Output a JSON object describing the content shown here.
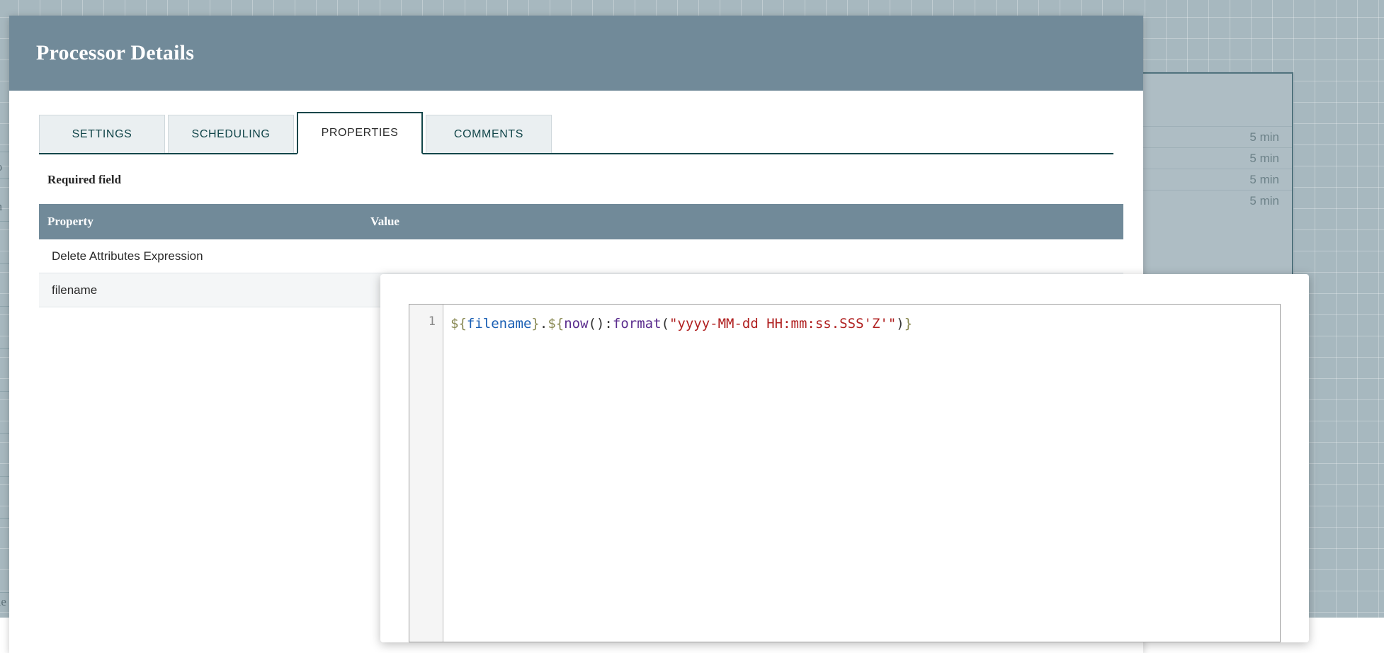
{
  "canvas": {
    "background_color": "#a7b8bf",
    "edge_fragments": [
      "to",
      "m",
      "n",
      "Re"
    ],
    "background_processor": {
      "border_color": "#50727d",
      "fill_color": "#aebdc4",
      "rows": [
        "5 min",
        "5 min",
        "5 min",
        "5 min"
      ]
    }
  },
  "dialog": {
    "title": "Processor Details",
    "header_color": "#718a99",
    "tabs": [
      {
        "label": "SETTINGS",
        "active": false
      },
      {
        "label": "SCHEDULING",
        "active": false
      },
      {
        "label": "PROPERTIES",
        "active": true
      },
      {
        "label": "COMMENTS",
        "active": false
      }
    ],
    "required_field_note": "Required field",
    "table": {
      "columns": [
        "Property",
        "Value"
      ],
      "rows": [
        {
          "property": "Delete Attributes Expression",
          "value": ""
        },
        {
          "property": "filename",
          "value": ""
        }
      ]
    }
  },
  "editor": {
    "line_number": "1",
    "expression": "${filename}.${now():format(\"yyyy-MM-dd HH:mm:ss.SSS'Z'\")}",
    "tokens": [
      {
        "text": "${",
        "kind": "el"
      },
      {
        "text": "filename",
        "kind": "attr"
      },
      {
        "text": "}",
        "kind": "el"
      },
      {
        "text": ".",
        "kind": "punct"
      },
      {
        "text": "${",
        "kind": "el"
      },
      {
        "text": "now",
        "kind": "func"
      },
      {
        "text": "()",
        "kind": "punct"
      },
      {
        "text": ":",
        "kind": "punct"
      },
      {
        "text": "format",
        "kind": "func"
      },
      {
        "text": "(",
        "kind": "punct"
      },
      {
        "text": "\"yyyy-MM-dd HH:mm:ss.SSS'Z'\"",
        "kind": "str"
      },
      {
        "text": ")",
        "kind": "punct"
      },
      {
        "text": "}",
        "kind": "el"
      }
    ]
  }
}
